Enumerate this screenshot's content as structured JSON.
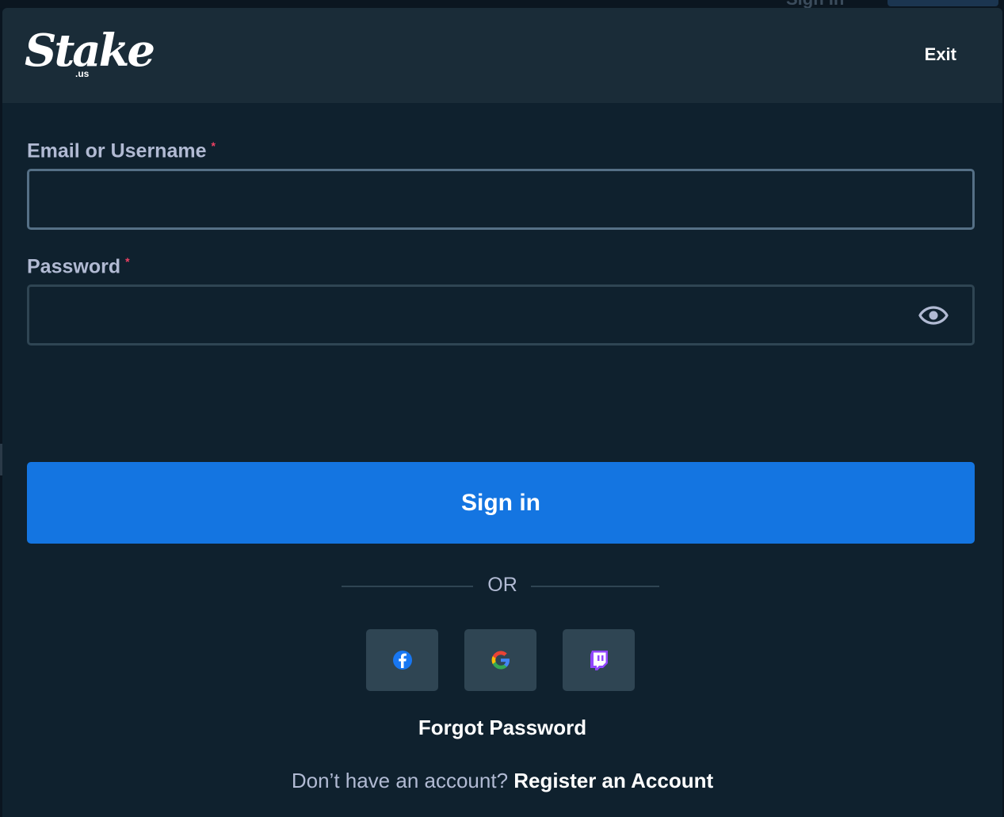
{
  "background_peek": {
    "text": "Sign In"
  },
  "header": {
    "logo_text": "Stake",
    "logo_sub": ".us",
    "exit_label": "Exit"
  },
  "form": {
    "email": {
      "label": "Email or Username",
      "required_mark": "*",
      "value": ""
    },
    "password": {
      "label": "Password",
      "required_mark": "*",
      "value": "",
      "toggle_icon": "eye-icon"
    },
    "submit_label": "Sign in"
  },
  "divider": {
    "text": "OR"
  },
  "social": [
    {
      "name": "facebook",
      "icon": "facebook-icon"
    },
    {
      "name": "google",
      "icon": "google-icon"
    },
    {
      "name": "twitch",
      "icon": "twitch-icon"
    }
  ],
  "forgot_label": "Forgot Password",
  "register": {
    "question": "Don’t have an account?",
    "link": "Register an Account"
  },
  "colors": {
    "background": "#0f212e",
    "header": "#1a2c38",
    "primary_button": "#1475e1",
    "input_border": "#2f4553",
    "label": "#b1bad3",
    "required": "#ed4163"
  }
}
